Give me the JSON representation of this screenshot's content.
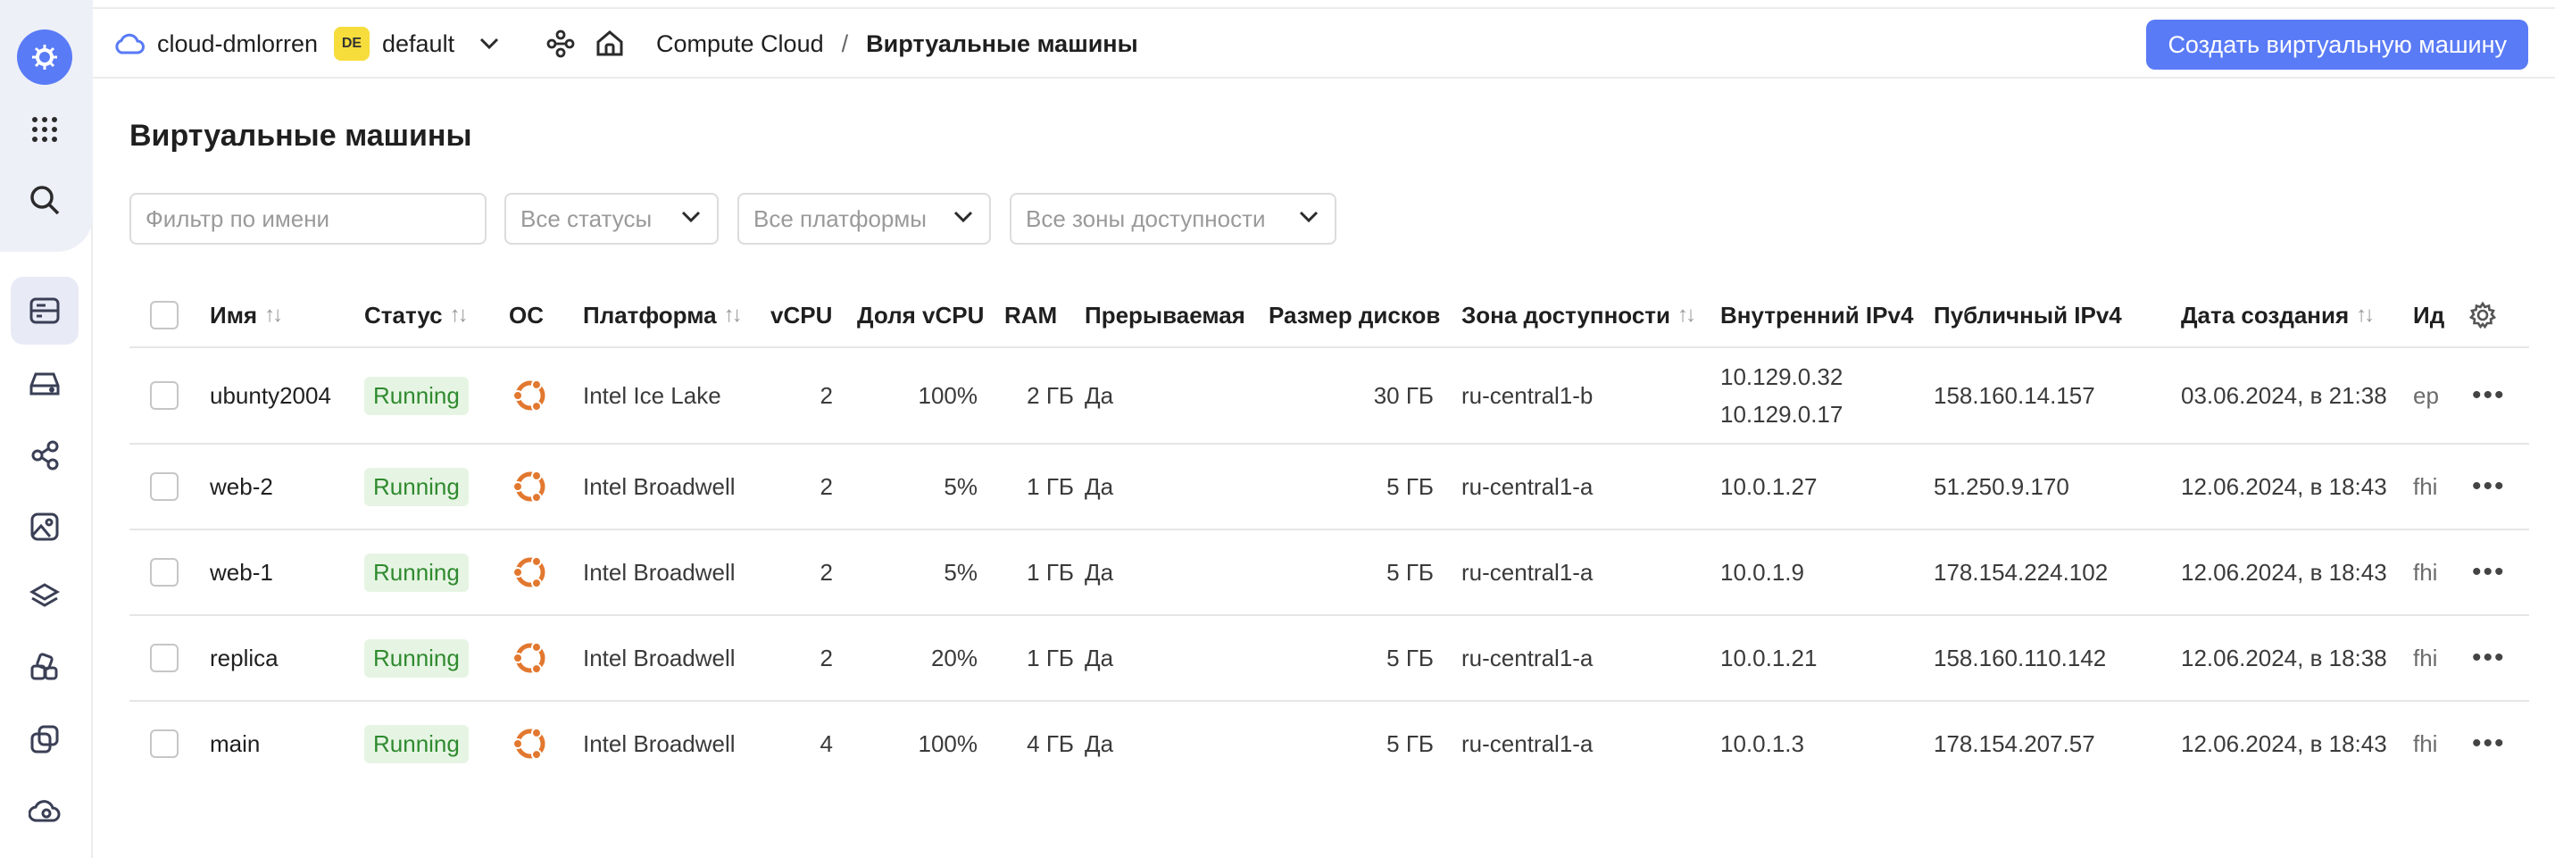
{
  "topbar": {
    "cloud_name": "cloud-dmlorren",
    "folder_badge": "DE",
    "folder_name": "default",
    "breadcrumb_service": "Compute Cloud",
    "breadcrumb_sep": "/",
    "breadcrumb_current": "Виртуальные машины",
    "create_button": "Создать виртуальную машину"
  },
  "page": {
    "title": "Виртуальные машины"
  },
  "filters": {
    "name_placeholder": "Фильтр по имени",
    "status": "Все статусы",
    "platform": "Все платформы",
    "zone": "Все зоны доступности"
  },
  "table": {
    "columns": {
      "name": "Имя",
      "status": "Статус",
      "os": "ОС",
      "platform": "Платформа",
      "vcpu": "vCPU",
      "vcpu_share": "Доля vCPU",
      "ram": "RAM",
      "preemptible": "Прерываемая",
      "disk": "Размер дисков",
      "zone": "Зона доступности",
      "internal_ip": "Внутренний IPv4",
      "public_ip": "Публичный IPv4",
      "created": "Дата создания",
      "id": "Ид"
    },
    "rows": [
      {
        "name": "ubunty2004",
        "status": "Running",
        "platform": "Intel Ice Lake",
        "vcpu": "2",
        "vcpu_share": "100%",
        "ram": "2 ГБ",
        "preemptible": "Да",
        "disk": "30 ГБ",
        "zone": "ru-central1-b",
        "internal_ip_1": "10.129.0.32",
        "internal_ip_2": "10.129.0.17",
        "public_ip": "158.160.14.157",
        "created": "03.06.2024, в 21:38",
        "id": "ep"
      },
      {
        "name": "web-2",
        "status": "Running",
        "platform": "Intel Broadwell",
        "vcpu": "2",
        "vcpu_share": "5%",
        "ram": "1 ГБ",
        "preemptible": "Да",
        "disk": "5 ГБ",
        "zone": "ru-central1-a",
        "internal_ip_1": "10.0.1.27",
        "public_ip": "51.250.9.170",
        "created": "12.06.2024, в 18:43",
        "id": "fhi"
      },
      {
        "name": "web-1",
        "status": "Running",
        "platform": "Intel Broadwell",
        "vcpu": "2",
        "vcpu_share": "5%",
        "ram": "1 ГБ",
        "preemptible": "Да",
        "disk": "5 ГБ",
        "zone": "ru-central1-a",
        "internal_ip_1": "10.0.1.9",
        "public_ip": "178.154.224.102",
        "created": "12.06.2024, в 18:43",
        "id": "fhi"
      },
      {
        "name": "replica",
        "status": "Running",
        "platform": "Intel Broadwell",
        "vcpu": "2",
        "vcpu_share": "20%",
        "ram": "1 ГБ",
        "preemptible": "Да",
        "disk": "5 ГБ",
        "zone": "ru-central1-a",
        "internal_ip_1": "10.0.1.21",
        "public_ip": "158.160.110.142",
        "created": "12.06.2024, в 18:38",
        "id": "fhi"
      },
      {
        "name": "main",
        "status": "Running",
        "platform": "Intel Broadwell",
        "vcpu": "4",
        "vcpu_share": "100%",
        "ram": "4 ГБ",
        "preemptible": "Да",
        "disk": "5 ГБ",
        "zone": "ru-central1-a",
        "internal_ip_1": "10.0.1.3",
        "public_ip": "178.154.207.57",
        "created": "12.06.2024, в 18:43",
        "id": "fhi"
      }
    ]
  },
  "icons": {
    "brand_color": "#5a7bf6",
    "ubuntu_color": "#e2782f",
    "status_color": "#2f8a2f"
  }
}
